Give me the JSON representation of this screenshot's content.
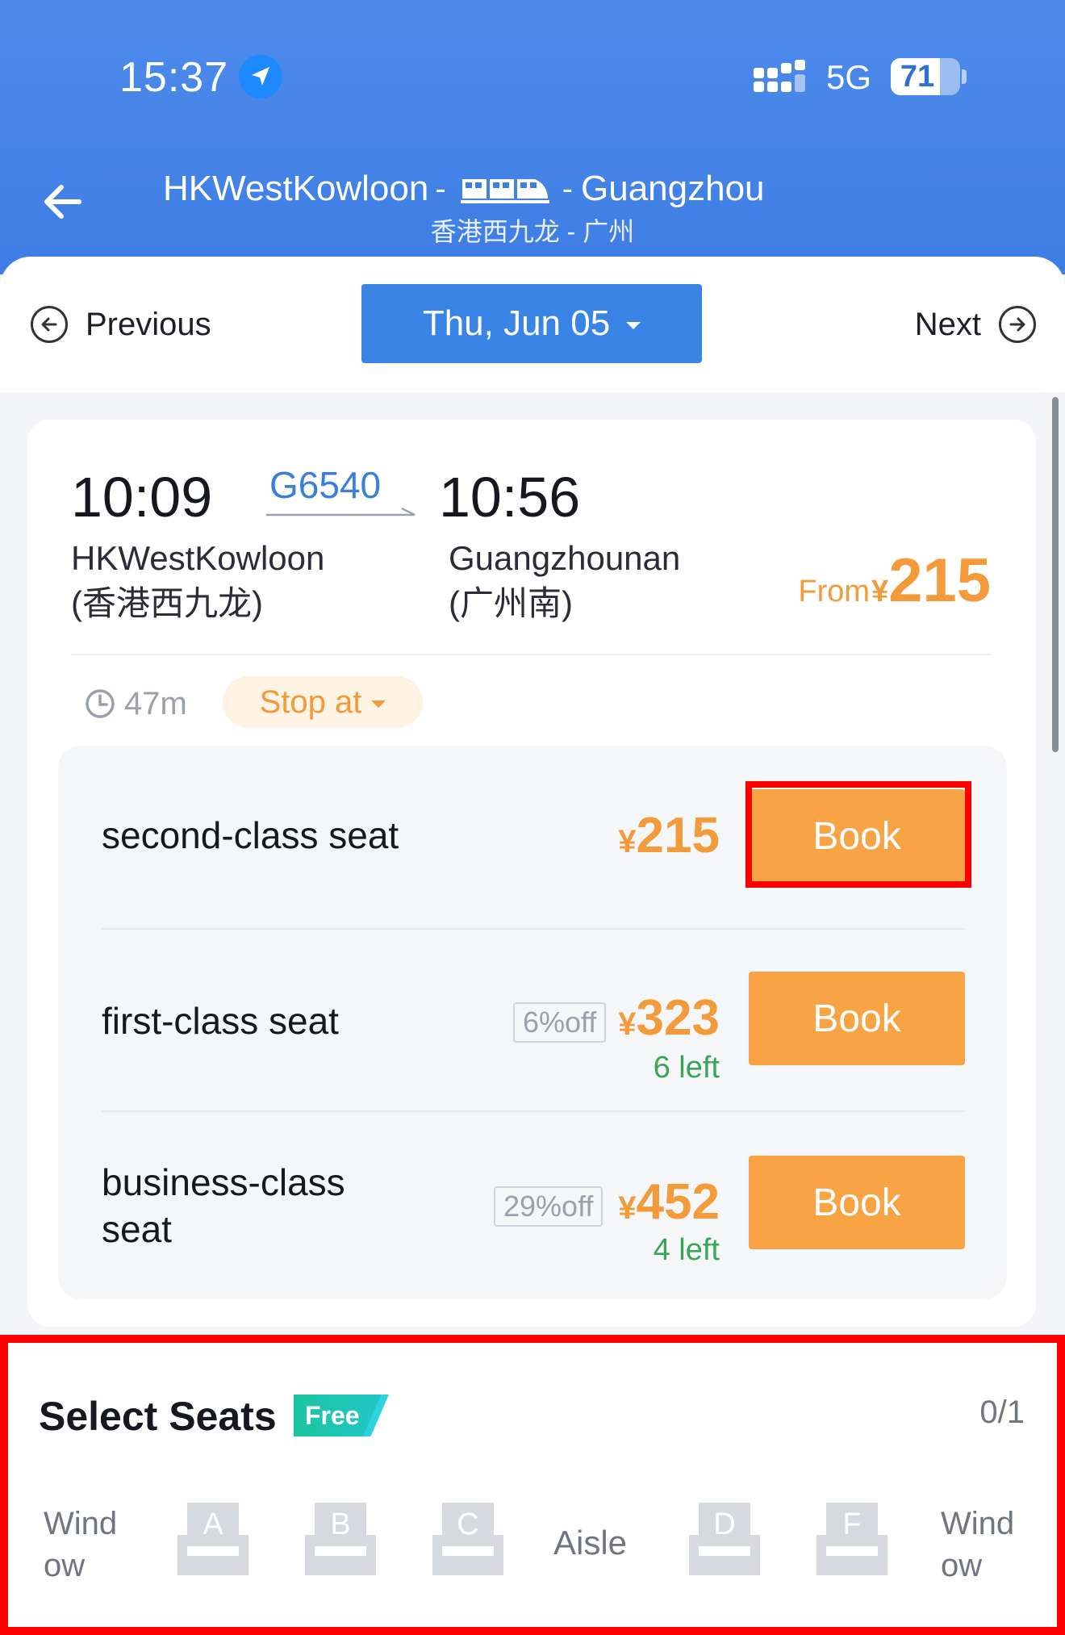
{
  "status_bar": {
    "time": "15:37",
    "network": "5G",
    "battery": "71",
    "battery_level": 0.71
  },
  "header": {
    "from_station": "HKWestKowloon",
    "to_station": "Guangzhou",
    "separator": "-",
    "subtitle": "香港西九龙 - 广州"
  },
  "date_bar": {
    "previous_label": "Previous",
    "date_label": "Thu, Jun 05",
    "next_label": "Next"
  },
  "train": {
    "departure_time": "10:09",
    "arrival_time": "10:56",
    "train_number": "G6540",
    "departure_station": "HKWestKowloon",
    "departure_station_cn": "(香港西九龙)",
    "arrival_station": "Guangzhounan",
    "arrival_station_cn": "(广州南)",
    "from_label": "From",
    "currency": "¥",
    "from_price": "215",
    "duration": "47m",
    "stop_label": "Stop at"
  },
  "seats": [
    {
      "name": "second-class seat",
      "currency": "¥",
      "price": "215",
      "discount": "",
      "left": "",
      "book_label": "Book"
    },
    {
      "name": "first-class seat",
      "currency": "¥",
      "price": "323",
      "discount": "6%off",
      "left": "6 left",
      "book_label": "Book"
    },
    {
      "name_line1": "business-class",
      "name_line2": "seat",
      "currency": "¥",
      "price": "452",
      "discount": "29%off",
      "left": "4 left",
      "book_label": "Book"
    }
  ],
  "select_seats": {
    "title": "Select Seats",
    "badge": "Free",
    "count": "0/1",
    "window_line1": "Wind",
    "window_line2": "ow",
    "aisle": "Aisle",
    "seat_letters": [
      "A",
      "B",
      "C",
      "D",
      "F"
    ]
  },
  "colors": {
    "header_blue": "#3e7de4",
    "accent_orange": "#f8a444",
    "price_orange": "#f39a3a",
    "green": "#3aa55a",
    "highlight_red": "#ff0000"
  },
  "icons": [
    "location-arrow-icon",
    "signal-icon",
    "back-arrow-icon",
    "train-icon",
    "prev-circle-arrow-icon",
    "next-circle-arrow-icon",
    "clock-icon",
    "seat-icon"
  ]
}
